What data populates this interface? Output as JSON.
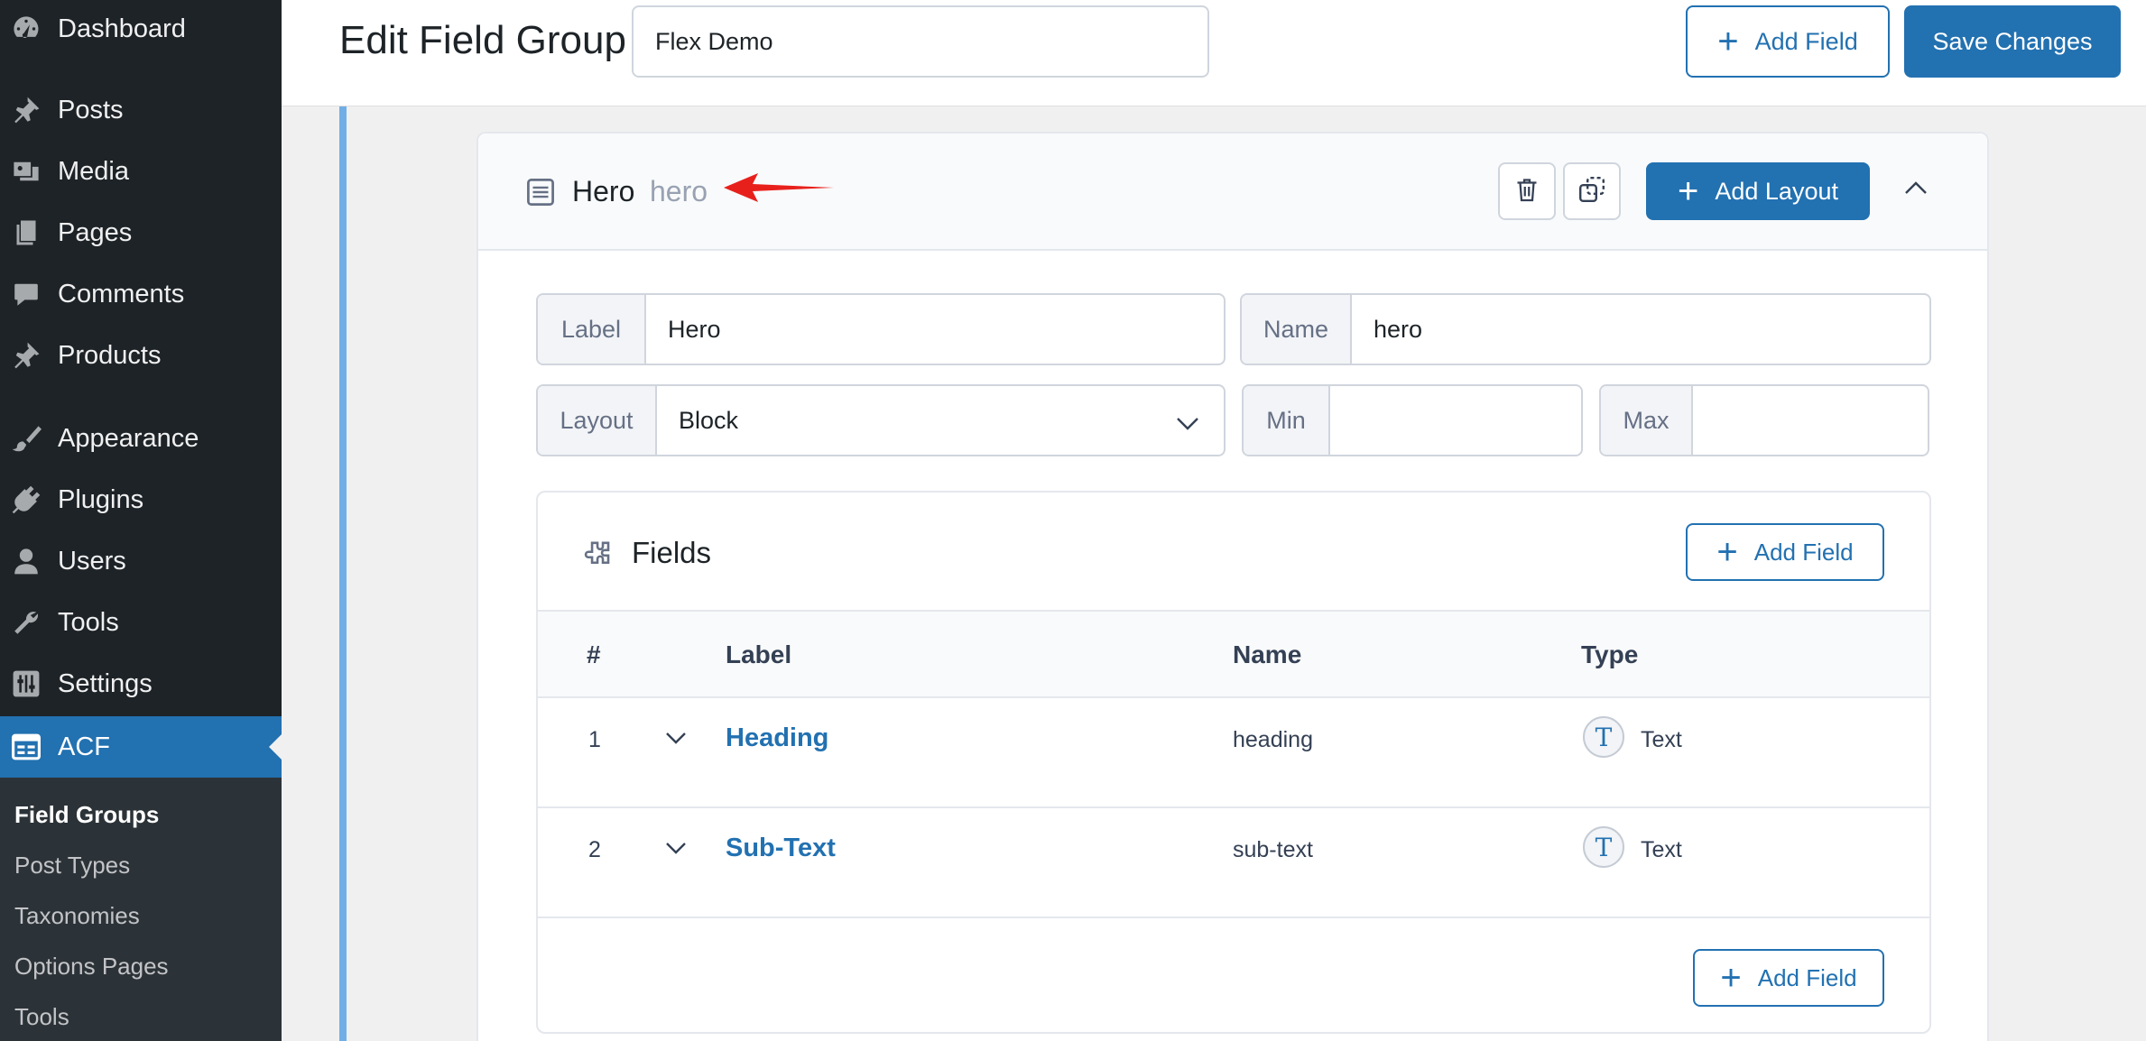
{
  "sidebar": {
    "items": [
      {
        "label": "Dashboard",
        "icon": "dashboard-icon"
      },
      {
        "label": "Posts",
        "icon": "pin-icon"
      },
      {
        "label": "Media",
        "icon": "media-icon"
      },
      {
        "label": "Pages",
        "icon": "pages-icon"
      },
      {
        "label": "Comments",
        "icon": "comment-icon"
      },
      {
        "label": "Products",
        "icon": "pin-icon"
      },
      {
        "label": "Appearance",
        "icon": "brush-icon"
      },
      {
        "label": "Plugins",
        "icon": "plug-icon"
      },
      {
        "label": "Users",
        "icon": "user-icon"
      },
      {
        "label": "Tools",
        "icon": "wrench-icon"
      },
      {
        "label": "Settings",
        "icon": "sliders-icon"
      },
      {
        "label": "ACF",
        "icon": "acf-icon",
        "active": true
      }
    ],
    "submenu": [
      "Field Groups",
      "Post Types",
      "Taxonomies",
      "Options Pages",
      "Tools"
    ]
  },
  "header": {
    "title": "Edit Field Group",
    "group_name": "Flex Demo",
    "add_field_label": "Add Field",
    "save_label": "Save Changes"
  },
  "layout": {
    "label": "Hero",
    "slug": "hero",
    "add_layout_label": "Add Layout",
    "settings": {
      "label_prefix": "Label",
      "label_value": "Hero",
      "name_prefix": "Name",
      "name_value": "hero",
      "layout_prefix": "Layout",
      "layout_value": "Block",
      "min_prefix": "Min",
      "min_value": "",
      "max_prefix": "Max",
      "max_value": ""
    }
  },
  "fields": {
    "title": "Fields",
    "add_field_label": "Add Field",
    "columns": [
      "#",
      "Label",
      "Name",
      "Type"
    ],
    "rows": [
      {
        "num": "1",
        "label": "Heading",
        "name": "heading",
        "type": "Text",
        "type_icon": "T"
      },
      {
        "num": "2",
        "label": "Sub-Text",
        "name": "sub-text",
        "type": "Text",
        "type_icon": "T"
      }
    ],
    "footer_add_label": "Add Field"
  },
  "colors": {
    "accent": "#2271b1",
    "sidebar_bg": "#1d2327",
    "annotation_arrow": "#e8201c"
  }
}
